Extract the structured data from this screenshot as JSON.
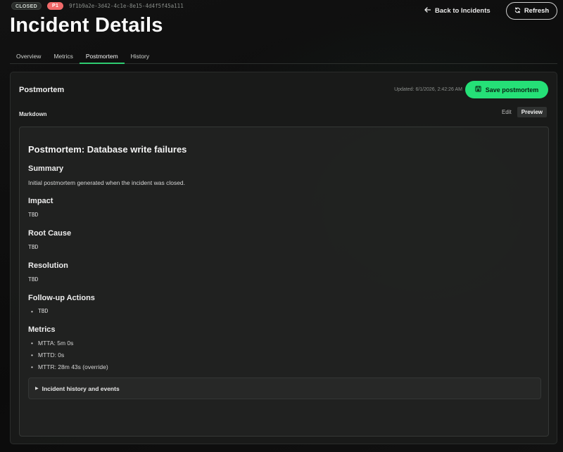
{
  "header": {
    "status_badge": "CLOSED",
    "priority_badge": "P1",
    "incident_id": "9f1b9a2e-3d42-4c1e-8e15-4d4f5f45a111",
    "title": "Incident Details",
    "back_label": "Back to Incidents",
    "refresh_label": "Refresh"
  },
  "tabs": [
    {
      "label": "Overview"
    },
    {
      "label": "Metrics"
    },
    {
      "label": "Postmortem"
    },
    {
      "label": "History"
    }
  ],
  "active_tab": "Postmortem",
  "postmortem": {
    "title": "Postmortem",
    "updated": "Updated: 6/1/2026, 2:42:26 AM",
    "save_label": "Save postmortem",
    "mode_label": "Markdown",
    "edit_label": "Edit",
    "preview_label": "Preview",
    "doc": {
      "h1": "Postmortem: Database write failures",
      "summary_heading": "Summary",
      "summary_text": "Initial postmortem generated when the incident was closed.",
      "impact_heading": "Impact",
      "impact_text": "TBD",
      "root_cause_heading": "Root Cause",
      "root_cause_text": "TBD",
      "resolution_heading": "Resolution",
      "resolution_text": "TBD",
      "followup_heading": "Follow-up Actions",
      "followup_items": [
        "TBD"
      ],
      "metrics_heading": "Metrics",
      "metrics_items": [
        "MTTA: 5m 0s",
        "MTTD: 0s",
        "MTTR: 28m 43s (override)"
      ],
      "details_label": "Incident history and events"
    }
  },
  "colors": {
    "accent": "#25e077",
    "priority": "#f06a6a",
    "background": "#0c0c0c"
  }
}
